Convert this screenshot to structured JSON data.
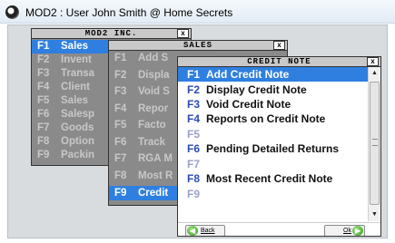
{
  "window": {
    "title": "MOD2 : User John Smith @ Home Secrets"
  },
  "close_label": "x",
  "mod2": {
    "title": "MOD2 INC.",
    "items": [
      {
        "key": "F1",
        "label": "Sales"
      },
      {
        "key": "F2",
        "label": "Invent"
      },
      {
        "key": "F3",
        "label": "Transa"
      },
      {
        "key": "F4",
        "label": "Client"
      },
      {
        "key": "F5",
        "label": "Sales"
      },
      {
        "key": "F6",
        "label": "Salesp"
      },
      {
        "key": "F7",
        "label": "Goods"
      },
      {
        "key": "F8",
        "label": "Option"
      },
      {
        "key": "F9",
        "label": "Packin"
      }
    ]
  },
  "sales": {
    "title": "SALES",
    "items": [
      {
        "key": "F1",
        "label": "Add S"
      },
      {
        "key": "F2",
        "label": "Displa"
      },
      {
        "key": "F3",
        "label": "Void S"
      },
      {
        "key": "F4",
        "label": "Repor"
      },
      {
        "key": "F5",
        "label": "Facto"
      },
      {
        "key": "F6",
        "label": "Track"
      },
      {
        "key": "F7",
        "label": "RGA M"
      },
      {
        "key": "F8",
        "label": "Most R"
      },
      {
        "key": "F9",
        "label": "Credit"
      }
    ]
  },
  "credit_note": {
    "title": "CREDIT NOTE",
    "items": [
      {
        "key": "F1",
        "label": "Add Credit Note"
      },
      {
        "key": "F2",
        "label": "Display Credit Note"
      },
      {
        "key": "F3",
        "label": "Void Credit Note"
      },
      {
        "key": "F4",
        "label": "Reports on Credit Note"
      },
      {
        "key": "F5",
        "label": ""
      },
      {
        "key": "F6",
        "label": "Pending Detailed Returns"
      },
      {
        "key": "F7",
        "label": ""
      },
      {
        "key": "F8",
        "label": "Most Recent Credit Note"
      },
      {
        "key": "F9",
        "label": ""
      }
    ]
  },
  "buttons": {
    "back_label": "Back",
    "ok_label": "Ok"
  },
  "colors": {
    "selection": "#2f7fe0",
    "window_body": "#8a8a8a",
    "key_blue": "#2b4ab6"
  },
  "icons": {
    "back": "back-arrow-icon",
    "ok": "forward-arrow-icon"
  }
}
